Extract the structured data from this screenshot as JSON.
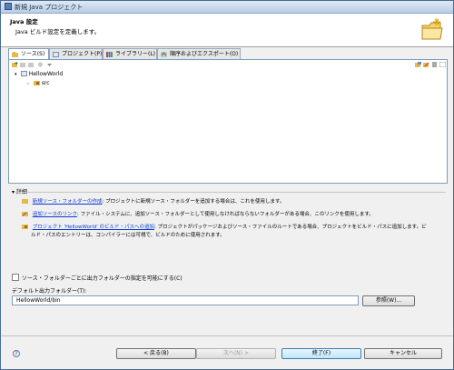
{
  "window": {
    "title": "新規 Java プロジェクト"
  },
  "banner": {
    "title": "Java 設定",
    "description": "Java ビルド設定を定義します。"
  },
  "tabs": [
    {
      "label": "ソース(S)",
      "active": true
    },
    {
      "label": "プロジェクト(P)"
    },
    {
      "label": "ライブラリー(L)"
    },
    {
      "label": "順序およびエクスポート(O)"
    }
  ],
  "tree": {
    "project": "HellowWorld",
    "folder": "src"
  },
  "details": {
    "label": "詳細",
    "items": [
      {
        "link": "新規ソース・フォルダーの作成",
        "text": ": プロジェクトに新規ソース・フォルダーを追加する場合は、これを使用します。"
      },
      {
        "link": "追加ソースのリンク",
        "text": ": ファイル・システムに、追加ソース・フォルダーとして使用しなければならないフォルダーがある場合、このリンクを使用します。"
      },
      {
        "link": "プロジェクト 'HellowWorld' のビルド・パスへの追加",
        "text": ": プロジェクトがパッケージおよびソース・ファイルのルートである場合、プロジェクトをビルド・パスに追加します。ビ",
        "text2": "ルド・パスのエントリーは、コンパイラーには可視で、ビルドのために使用されます。"
      }
    ]
  },
  "options": {
    "output_checkbox_label": "ソース・フォルダーごとに出力フォルダーの指定を可能にする(C)",
    "output_checked": false
  },
  "output": {
    "label": "デフォルト出力フォルダー(T):",
    "value": "HellowWorld/bin",
    "browse": "参照(W)..."
  },
  "buttons": {
    "back": "< 戻る(B)",
    "next": "次へ(N) >",
    "finish": "終了(F)",
    "cancel": "キャンセル"
  },
  "colors": {
    "link": "#0b3bd1",
    "accent": "#3c7fb1"
  }
}
